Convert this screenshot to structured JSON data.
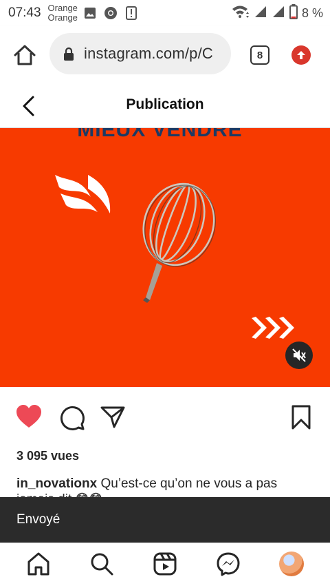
{
  "status_bar": {
    "time": "07:43",
    "carrier_line1": "Orange",
    "carrier_line2": "Orange",
    "battery": "8 %",
    "icons": [
      "image-icon",
      "chrome-icon",
      "alert-icon",
      "wifi-icon",
      "signal-icon",
      "signal-icon",
      "battery-icon"
    ]
  },
  "browser": {
    "url": "instagram.com/p/C",
    "tab_count": "8"
  },
  "header": {
    "title": "Publication"
  },
  "post": {
    "media_caption": "MIEUX VENDRE\"",
    "views": "3 095 vues",
    "username": "in_novationx",
    "caption_text": " Qu’est-ce qu’on ne vous a pas",
    "caption_cut": "jamais dit 😳😳"
  },
  "toast": {
    "text": "Envoyé"
  },
  "nav": {
    "items": [
      "home-icon",
      "search-icon",
      "reels-icon",
      "messenger-icon",
      "profile-avatar"
    ]
  },
  "colors": {
    "media_bg": "#f73a00",
    "like_red": "#ed4956",
    "toast_bg": "#2b2b2b"
  }
}
